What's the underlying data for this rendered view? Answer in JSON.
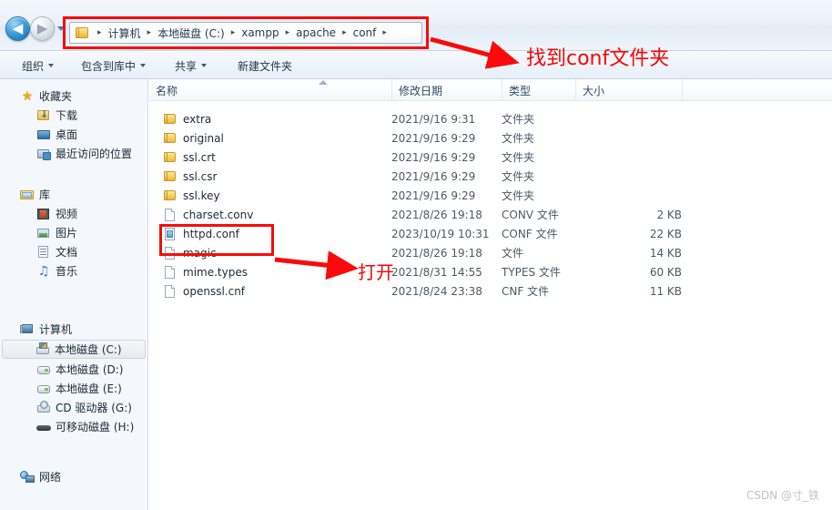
{
  "window": {
    "nav": {
      "back_label": "◀",
      "forward_label": "▶",
      "history_dropdown": "history-dropdown"
    },
    "breadcrumb": {
      "separator": "▸",
      "items": [
        "计算机",
        "本地磁盘 (C:)",
        "xampp",
        "apache",
        "conf"
      ]
    },
    "toolbar": {
      "items": [
        {
          "label": "组织",
          "caret": true
        },
        {
          "label": "包含到库中",
          "caret": true
        },
        {
          "label": "共享",
          "caret": true
        },
        {
          "label": "新建文件夹",
          "caret": false
        }
      ]
    }
  },
  "sidebar": {
    "groups": [
      {
        "header": {
          "label": "收藏夹",
          "icon": "star-icon"
        },
        "items": [
          {
            "label": "下载",
            "icon": "download-folder-icon"
          },
          {
            "label": "桌面",
            "icon": "desktop-icon"
          },
          {
            "label": "最近访问的位置",
            "icon": "recent-places-icon"
          }
        ]
      },
      {
        "header": {
          "label": "库",
          "icon": "library-icon"
        },
        "items": [
          {
            "label": "视频",
            "icon": "video-icon"
          },
          {
            "label": "图片",
            "icon": "picture-icon"
          },
          {
            "label": "文档",
            "icon": "document-icon"
          },
          {
            "label": "音乐",
            "icon": "music-icon"
          }
        ]
      },
      {
        "header": {
          "label": "计算机",
          "icon": "computer-icon"
        },
        "items": [
          {
            "label": "本地磁盘 (C:)",
            "icon": "system-drive-icon",
            "selected": true
          },
          {
            "label": "本地磁盘 (D:)",
            "icon": "drive-icon",
            "selected": false
          },
          {
            "label": "本地磁盘 (E:)",
            "icon": "drive-icon",
            "selected": false
          },
          {
            "label": "CD 驱动器 (G:)",
            "icon": "cd-drive-icon",
            "selected": false
          },
          {
            "label": "可移动磁盘 (H:)",
            "icon": "removable-drive-icon",
            "selected": false
          }
        ]
      },
      {
        "header": {
          "label": "网络",
          "icon": "network-icon"
        },
        "items": []
      }
    ]
  },
  "file_list": {
    "columns": [
      {
        "key": "name",
        "label": "名称"
      },
      {
        "key": "date",
        "label": "修改日期"
      },
      {
        "key": "type",
        "label": "类型"
      },
      {
        "key": "size",
        "label": "大小"
      }
    ],
    "sort_column": "name",
    "rows": [
      {
        "name": "extra",
        "date": "2021/9/16 9:31",
        "type": "文件夹",
        "size": "",
        "icon": "folder-icon"
      },
      {
        "name": "original",
        "date": "2021/9/16 9:29",
        "type": "文件夹",
        "size": "",
        "icon": "folder-icon"
      },
      {
        "name": "ssl.crt",
        "date": "2021/9/16 9:29",
        "type": "文件夹",
        "size": "",
        "icon": "folder-icon"
      },
      {
        "name": "ssl.csr",
        "date": "2021/9/16 9:29",
        "type": "文件夹",
        "size": "",
        "icon": "folder-icon"
      },
      {
        "name": "ssl.key",
        "date": "2021/9/16 9:29",
        "type": "文件夹",
        "size": "",
        "icon": "folder-icon"
      },
      {
        "name": "charset.conv",
        "date": "2021/8/26 19:18",
        "type": "CONV 文件",
        "size": "2 KB",
        "icon": "file-icon"
      },
      {
        "name": "httpd.conf",
        "date": "2023/10/19 10:31",
        "type": "CONF 文件",
        "size": "22 KB",
        "icon": "conf-file-icon"
      },
      {
        "name": "magic",
        "date": "2021/8/26 19:18",
        "type": "文件",
        "size": "14 KB",
        "icon": "file-icon"
      },
      {
        "name": "mime.types",
        "date": "2021/8/31 14:55",
        "type": "TYPES 文件",
        "size": "60 KB",
        "icon": "file-icon"
      },
      {
        "name": "openssl.cnf",
        "date": "2021/8/24 23:38",
        "type": "CNF 文件",
        "size": "11 KB",
        "icon": "file-icon"
      }
    ]
  },
  "annotations": {
    "accent_color": "#fa0a0a",
    "find_conf_text": "找到conf文件夹",
    "open_text": "打开"
  },
  "watermark": {
    "text": "CSDN @寸_铁"
  }
}
